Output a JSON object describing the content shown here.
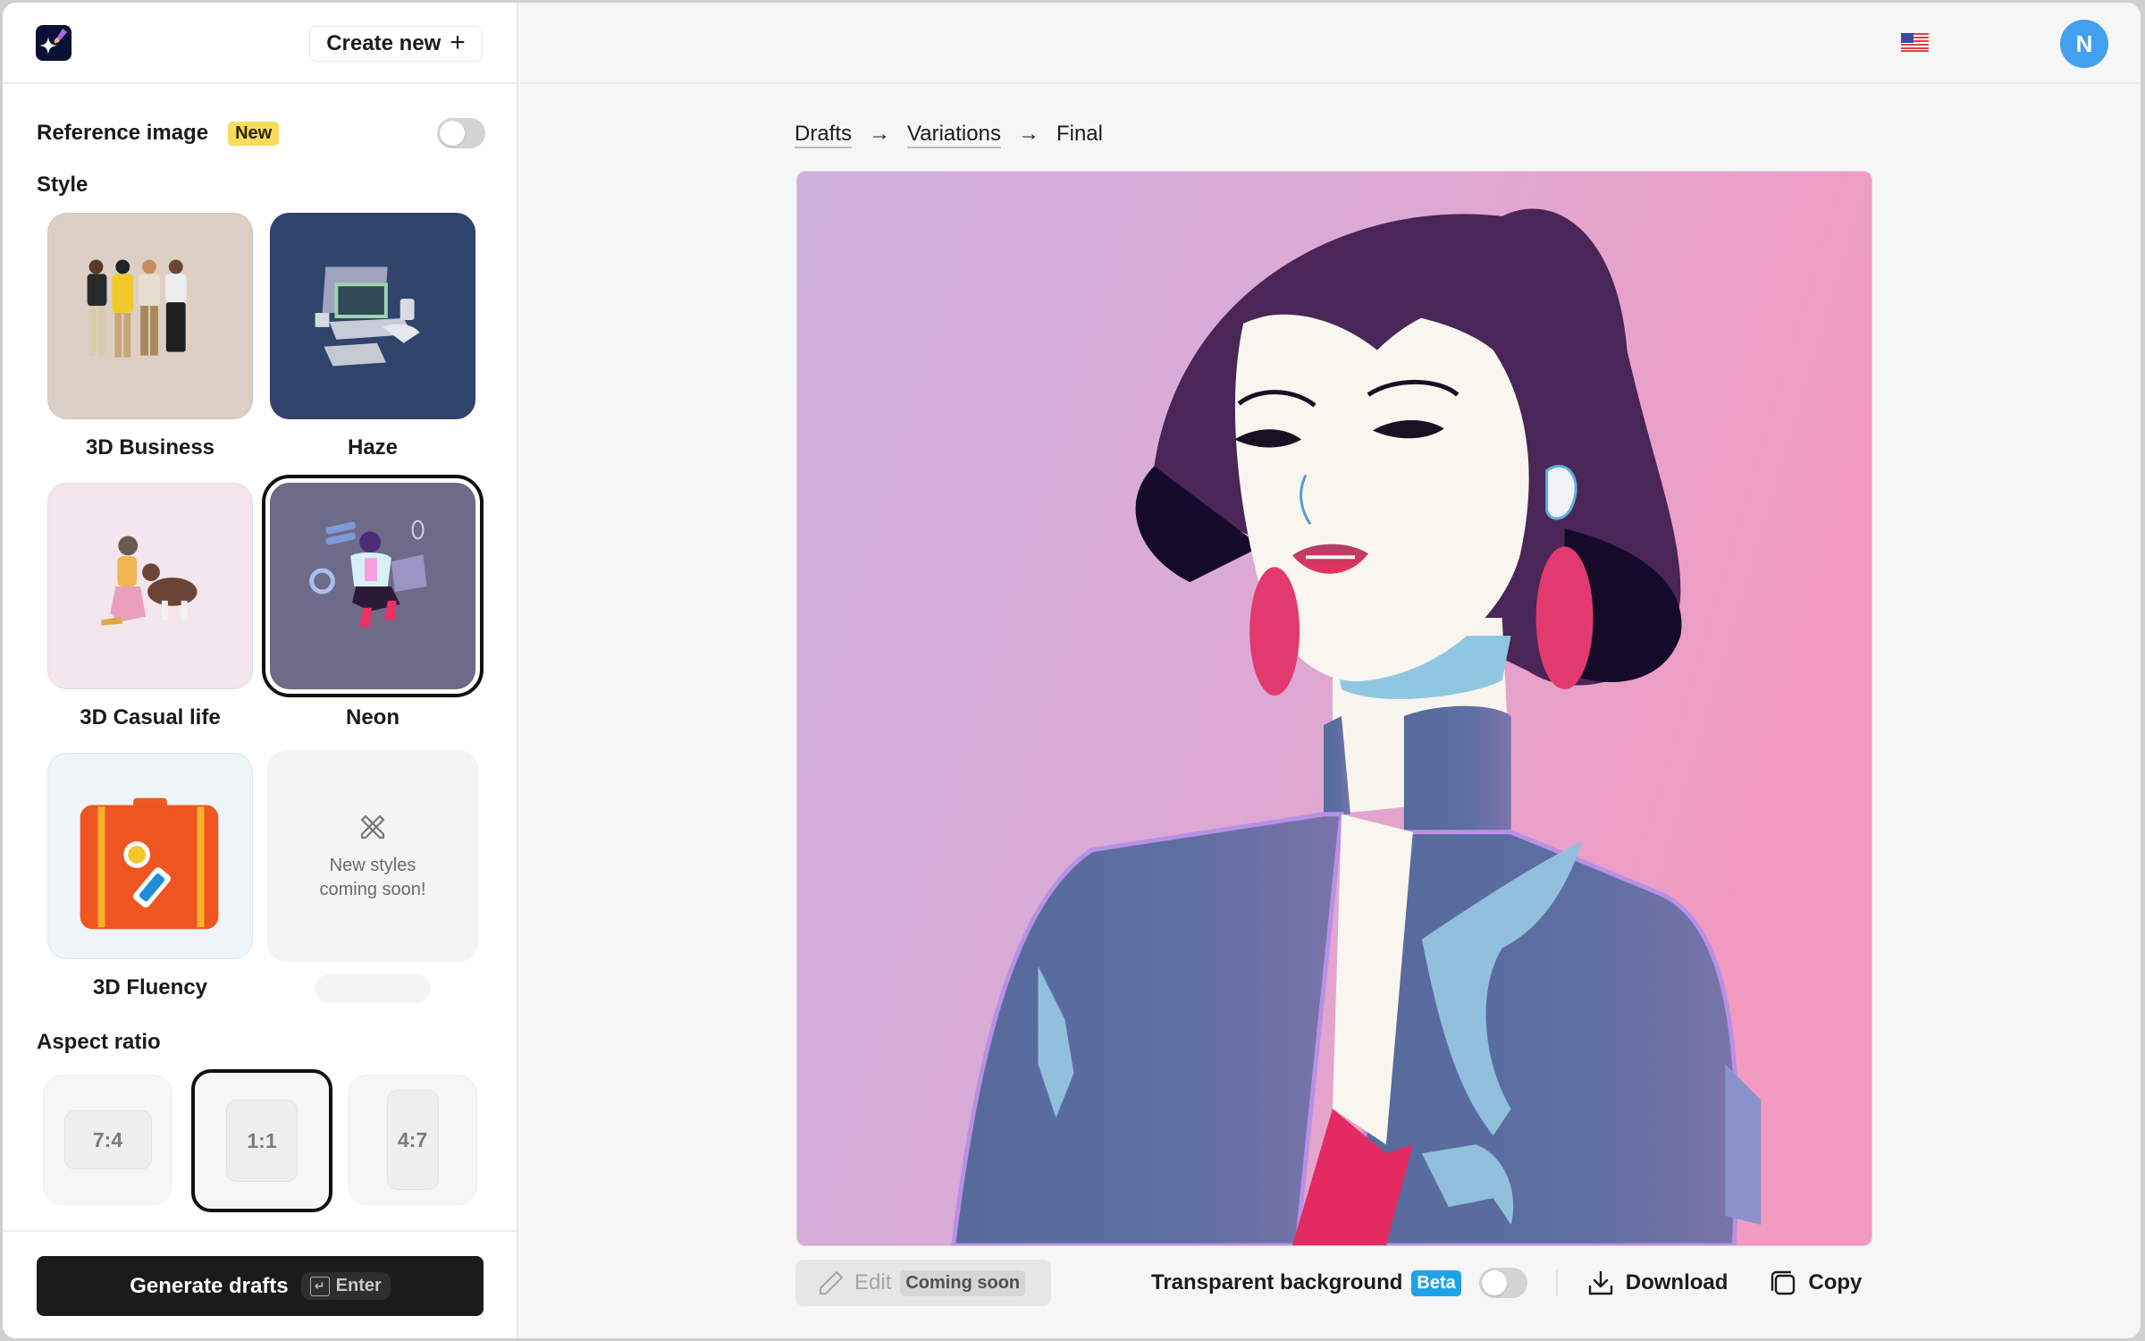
{
  "app": {
    "logo_icon": "sparkle-brush-icon",
    "create_new_label": "Create new",
    "create_new_icon": "plus-icon"
  },
  "sidebar": {
    "reference_image": {
      "label": "Reference image",
      "badge": "New",
      "enabled": false
    },
    "style_title": "Style",
    "styles": [
      {
        "label": "3D Business",
        "selected": false,
        "bg": "#dcd0c6"
      },
      {
        "label": "Haze",
        "selected": false,
        "bg": "#30436a"
      },
      {
        "label": "3D Casual life",
        "selected": false,
        "bg": "#f3e6ec"
      },
      {
        "label": "Neon",
        "selected": true,
        "bg": "#6e6b89"
      },
      {
        "label": "3D Fluency",
        "selected": false,
        "bg": "#eef4f8"
      }
    ],
    "coming_soon": {
      "text_line1": "New styles",
      "text_line2": "coming soon!",
      "icon": "pencil-ruler-icon"
    },
    "aspect_ratio_title": "Aspect ratio",
    "aspect_ratios": [
      {
        "label": "7:4",
        "selected": false
      },
      {
        "label": "1:1",
        "selected": true
      },
      {
        "label": "4:7",
        "selected": false
      }
    ],
    "generate": {
      "label": "Generate drafts",
      "shortcut": "Enter",
      "shortcut_icon": "enter-key-icon"
    }
  },
  "header": {
    "language_icon": "us-flag-icon",
    "avatar_initial": "N",
    "avatar_color": "#43a0ee"
  },
  "breadcrumb": [
    {
      "label": "Drafts",
      "link": true
    },
    {
      "label": "Variations",
      "link": true
    },
    {
      "label": "Final",
      "link": false
    }
  ],
  "breadcrumb_separator": "→",
  "artwork": {
    "description": "Neon-style illustration of a woman with dark purple hair, red earrings and a blue jacket on a lilac-to-pink gradient"
  },
  "toolbar": {
    "edit_label": "Edit",
    "edit_badge": "Coming soon",
    "transparent_label": "Transparent background",
    "transparent_badge": "Beta",
    "transparent_enabled": false,
    "download_label": "Download",
    "copy_label": "Copy"
  },
  "colors": {
    "accent_badge_new": "#f7dc5c",
    "accent_badge_beta": "#1ea3e8",
    "primary_button": "#1b1b1b"
  }
}
